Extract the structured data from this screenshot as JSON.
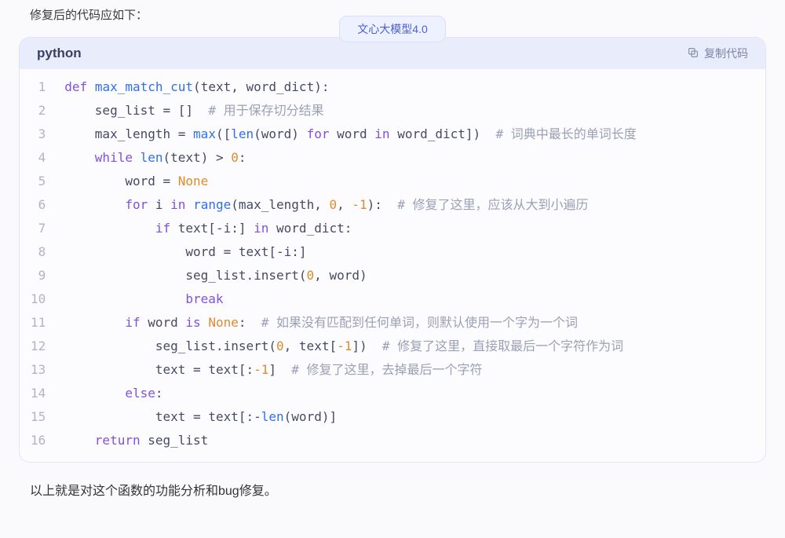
{
  "intro_text": "修复后的代码应如下：",
  "model_badge": "文心大模型4.0",
  "code": {
    "language_label": "python",
    "copy_label": "复制代码",
    "line_count": 16,
    "lines": [
      [
        [
          "kw",
          "def"
        ],
        [
          "sp",
          " "
        ],
        [
          "fn",
          "max_match_cut"
        ],
        [
          "punct",
          "("
        ],
        [
          "id",
          "text"
        ],
        [
          "punct",
          ","
        ],
        [
          "sp",
          " "
        ],
        [
          "id",
          "word_dict"
        ],
        [
          "punct",
          "):"
        ]
      ],
      [
        [
          "indent",
          1
        ],
        [
          "id",
          "seg_list"
        ],
        [
          "sp",
          " "
        ],
        [
          "op",
          "="
        ],
        [
          "sp",
          " "
        ],
        [
          "punct",
          "[]"
        ],
        [
          "sp",
          "  "
        ],
        [
          "cmt",
          "# 用于保存切分结果"
        ]
      ],
      [
        [
          "indent",
          1
        ],
        [
          "id",
          "max_length"
        ],
        [
          "sp",
          " "
        ],
        [
          "op",
          "="
        ],
        [
          "sp",
          " "
        ],
        [
          "fn",
          "max"
        ],
        [
          "punct",
          "(["
        ],
        [
          "fn",
          "len"
        ],
        [
          "punct",
          "("
        ],
        [
          "id",
          "word"
        ],
        [
          "punct",
          ")"
        ],
        [
          "sp",
          " "
        ],
        [
          "kw",
          "for"
        ],
        [
          "sp",
          " "
        ],
        [
          "id",
          "word"
        ],
        [
          "sp",
          " "
        ],
        [
          "kw",
          "in"
        ],
        [
          "sp",
          " "
        ],
        [
          "id",
          "word_dict"
        ],
        [
          "punct",
          "])"
        ],
        [
          "sp",
          "  "
        ],
        [
          "cmt",
          "# 词典中最长的单词长度"
        ]
      ],
      [
        [
          "indent",
          1
        ],
        [
          "kw",
          "while"
        ],
        [
          "sp",
          " "
        ],
        [
          "fn",
          "len"
        ],
        [
          "punct",
          "("
        ],
        [
          "id",
          "text"
        ],
        [
          "punct",
          ")"
        ],
        [
          "sp",
          " "
        ],
        [
          "op",
          ">"
        ],
        [
          "sp",
          " "
        ],
        [
          "num",
          "0"
        ],
        [
          "punct",
          ":"
        ]
      ],
      [
        [
          "indent",
          2
        ],
        [
          "id",
          "word"
        ],
        [
          "sp",
          " "
        ],
        [
          "op",
          "="
        ],
        [
          "sp",
          " "
        ],
        [
          "builtin",
          "None"
        ]
      ],
      [
        [
          "indent",
          2
        ],
        [
          "kw",
          "for"
        ],
        [
          "sp",
          " "
        ],
        [
          "id",
          "i"
        ],
        [
          "sp",
          " "
        ],
        [
          "kw",
          "in"
        ],
        [
          "sp",
          " "
        ],
        [
          "fn",
          "range"
        ],
        [
          "punct",
          "("
        ],
        [
          "id",
          "max_length"
        ],
        [
          "punct",
          ","
        ],
        [
          "sp",
          " "
        ],
        [
          "num",
          "0"
        ],
        [
          "punct",
          ","
        ],
        [
          "sp",
          " "
        ],
        [
          "num",
          "-1"
        ],
        [
          "punct",
          "):"
        ],
        [
          "sp",
          "  "
        ],
        [
          "cmt",
          "# 修复了这里，应该从大到小遍历"
        ]
      ],
      [
        [
          "indent",
          3
        ],
        [
          "kw",
          "if"
        ],
        [
          "sp",
          " "
        ],
        [
          "id",
          "text"
        ],
        [
          "punct",
          "["
        ],
        [
          "op",
          "-"
        ],
        [
          "id",
          "i"
        ],
        [
          "punct",
          ":]"
        ],
        [
          "sp",
          " "
        ],
        [
          "kw",
          "in"
        ],
        [
          "sp",
          " "
        ],
        [
          "id",
          "word_dict"
        ],
        [
          "punct",
          ":"
        ]
      ],
      [
        [
          "indent",
          4
        ],
        [
          "id",
          "word"
        ],
        [
          "sp",
          " "
        ],
        [
          "op",
          "="
        ],
        [
          "sp",
          " "
        ],
        [
          "id",
          "text"
        ],
        [
          "punct",
          "["
        ],
        [
          "op",
          "-"
        ],
        [
          "id",
          "i"
        ],
        [
          "punct",
          ":]"
        ]
      ],
      [
        [
          "indent",
          4
        ],
        [
          "id",
          "seg_list"
        ],
        [
          "punct",
          "."
        ],
        [
          "id",
          "insert"
        ],
        [
          "punct",
          "("
        ],
        [
          "num",
          "0"
        ],
        [
          "punct",
          ","
        ],
        [
          "sp",
          " "
        ],
        [
          "id",
          "word"
        ],
        [
          "punct",
          ")"
        ]
      ],
      [
        [
          "indent",
          4
        ],
        [
          "kw",
          "break"
        ]
      ],
      [
        [
          "indent",
          2
        ],
        [
          "kw",
          "if"
        ],
        [
          "sp",
          " "
        ],
        [
          "id",
          "word"
        ],
        [
          "sp",
          " "
        ],
        [
          "kw",
          "is"
        ],
        [
          "sp",
          " "
        ],
        [
          "builtin",
          "None"
        ],
        [
          "punct",
          ":"
        ],
        [
          "sp",
          "  "
        ],
        [
          "cmt",
          "# 如果没有匹配到任何单词，则默认使用一个字为一个词"
        ]
      ],
      [
        [
          "indent",
          3
        ],
        [
          "id",
          "seg_list"
        ],
        [
          "punct",
          "."
        ],
        [
          "id",
          "insert"
        ],
        [
          "punct",
          "("
        ],
        [
          "num",
          "0"
        ],
        [
          "punct",
          ","
        ],
        [
          "sp",
          " "
        ],
        [
          "id",
          "text"
        ],
        [
          "punct",
          "["
        ],
        [
          "num",
          "-1"
        ],
        [
          "punct",
          "])"
        ],
        [
          "sp",
          "  "
        ],
        [
          "cmt",
          "# 修复了这里，直接取最后一个字符作为词"
        ]
      ],
      [
        [
          "indent",
          3
        ],
        [
          "id",
          "text"
        ],
        [
          "sp",
          " "
        ],
        [
          "op",
          "="
        ],
        [
          "sp",
          " "
        ],
        [
          "id",
          "text"
        ],
        [
          "punct",
          "[:"
        ],
        [
          "num",
          "-1"
        ],
        [
          "punct",
          "]"
        ],
        [
          "sp",
          "  "
        ],
        [
          "cmt",
          "# 修复了这里，去掉最后一个字符"
        ]
      ],
      [
        [
          "indent",
          2
        ],
        [
          "kw",
          "else"
        ],
        [
          "punct",
          ":"
        ]
      ],
      [
        [
          "indent",
          3
        ],
        [
          "id",
          "text"
        ],
        [
          "sp",
          " "
        ],
        [
          "op",
          "="
        ],
        [
          "sp",
          " "
        ],
        [
          "id",
          "text"
        ],
        [
          "punct",
          "[:-"
        ],
        [
          "fn",
          "len"
        ],
        [
          "punct",
          "("
        ],
        [
          "id",
          "word"
        ],
        [
          "punct",
          ")]"
        ]
      ],
      [
        [
          "indent",
          1
        ],
        [
          "kw",
          "return"
        ],
        [
          "sp",
          " "
        ],
        [
          "id",
          "seg_list"
        ]
      ]
    ]
  },
  "outro_text": "以上就是对这个函数的功能分析和bug修复。"
}
